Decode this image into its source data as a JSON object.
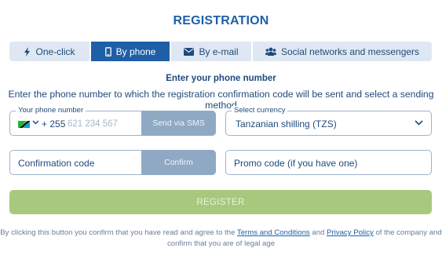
{
  "title": "REGISTRATION",
  "tabs": [
    {
      "label": "One-click",
      "icon": "lightning-icon",
      "active": false
    },
    {
      "label": "By phone",
      "icon": "phone-icon",
      "active": true
    },
    {
      "label": "By e-mail",
      "icon": "envelope-icon",
      "active": false
    },
    {
      "label": "Social networks and messengers",
      "icon": "users-icon",
      "active": false
    }
  ],
  "subtitle": "Enter your phone number",
  "instruction": "Enter the phone number to which the registration confirmation code will be sent and select a sending method",
  "phone": {
    "legend": "Your phone number",
    "country_code": "+ 255",
    "placeholder": "621 234 567",
    "send_button": "Send via SMS",
    "flag_icon": "tanzania-flag-icon"
  },
  "currency": {
    "legend": "Select currency",
    "value": "Tanzanian shilling (TZS)"
  },
  "confirmation": {
    "placeholder": "Confirmation code",
    "button": "Confirm"
  },
  "promo": {
    "placeholder": "Promo code (if you have one)"
  },
  "register_button": "REGISTER",
  "terms": {
    "prefix": "By clicking this button you confirm that you have read and agree to the",
    "terms_link": "Terms and Conditions",
    "and": "and",
    "privacy_link": "Privacy Policy",
    "suffix": "of the company and confirm that you are of legal age"
  },
  "colors": {
    "brand_blue": "#1f5fa8",
    "disabled_button": "#8fa9c4",
    "register_green": "#a8c97d",
    "tab_background": "#dfe8f2"
  }
}
